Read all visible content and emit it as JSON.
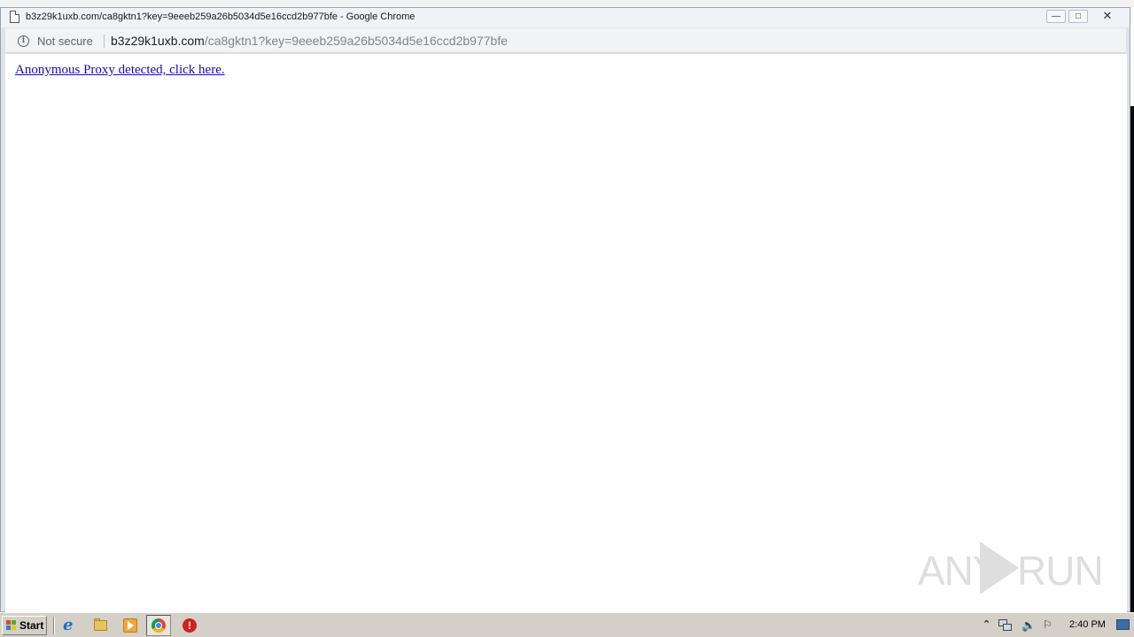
{
  "window": {
    "title": "b3z29k1uxb.com/ca8gktn1?key=9eeeb259a26b5034d5e16ccd2b977bfe - Google Chrome",
    "minimize_glyph": "—",
    "maximize_glyph": "□",
    "close_glyph": "✕"
  },
  "addressbar": {
    "security_label": "Not secure",
    "url_host": "b3z29k1uxb.com",
    "url_path": "/ca8gktn1?key=9eeeb259a26b5034d5e16ccd2b977bfe"
  },
  "page": {
    "link_text": "Anonymous Proxy detected, click here."
  },
  "watermark": {
    "left": "ANY",
    "right": "RUN"
  },
  "taskbar": {
    "start_label": "Start",
    "pinned": [
      "internet-explorer-icon",
      "folder-icon",
      "media-player-icon",
      "chrome-icon",
      "stop-icon"
    ],
    "tray": {
      "show_hidden_glyph": "⌃",
      "volume_glyph": "🔈",
      "flag_glyph": "⚐"
    },
    "clock": "2:40 PM"
  },
  "colors": {
    "link": "#1a0dab",
    "address_bar_bg": "#f1f3f4",
    "taskbar_bg": "#d4d0c8"
  }
}
